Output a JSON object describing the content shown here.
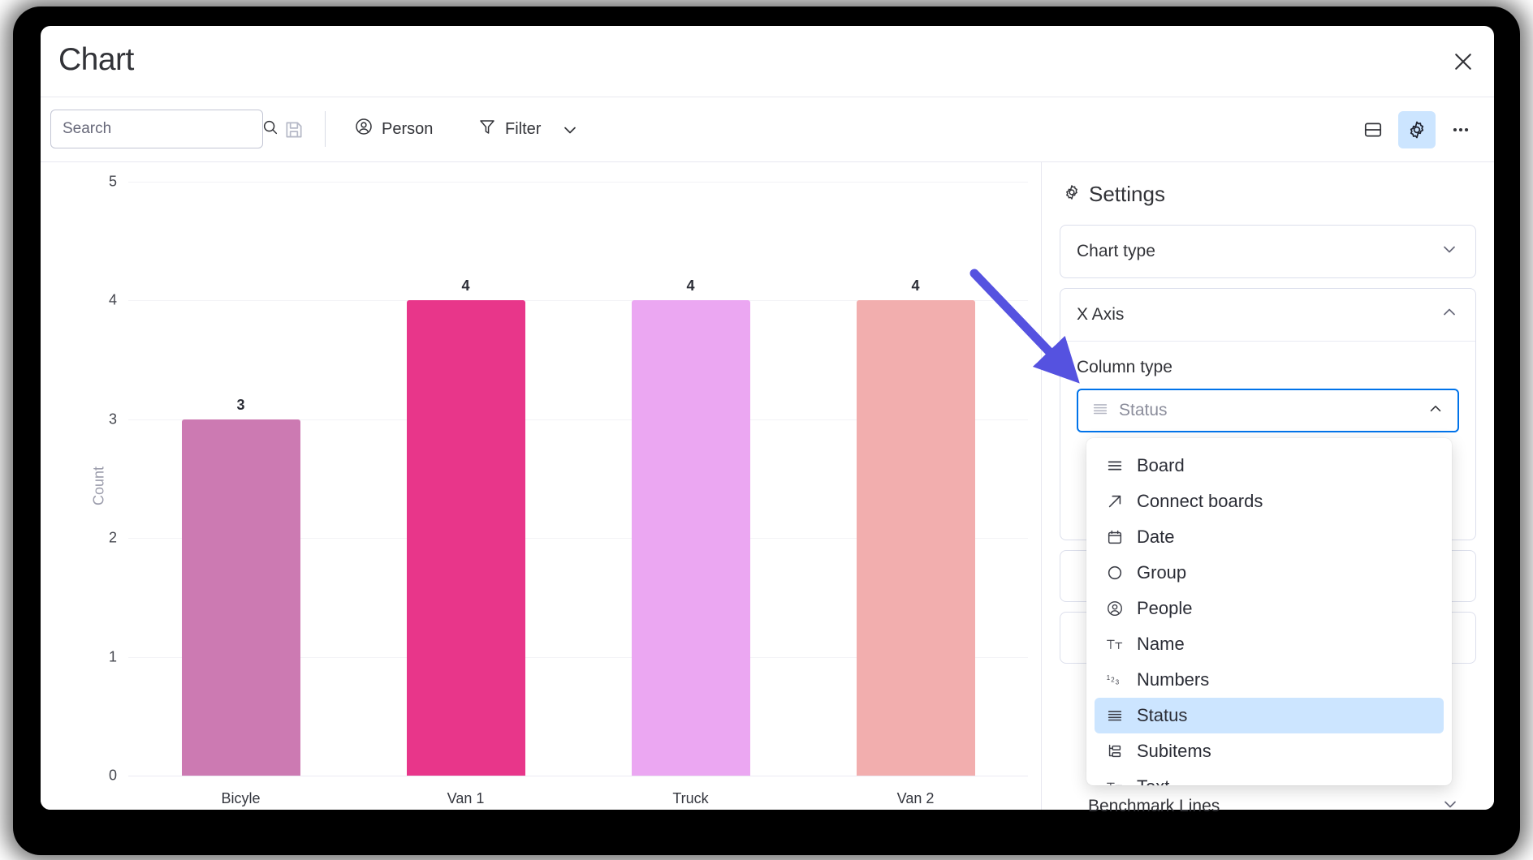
{
  "window": {
    "title": "Chart",
    "close_icon": "close-icon"
  },
  "toolbar": {
    "search": {
      "placeholder": "Search",
      "value": "",
      "icon": "search-icon"
    },
    "save_icon": "save-disk-icon",
    "person": {
      "label": "Person",
      "icon": "person-circle-icon"
    },
    "filter": {
      "label": "Filter",
      "icon": "funnel-icon",
      "chevron": "chevron-down-icon"
    },
    "right_icons": [
      {
        "name": "split-view-icon",
        "active": false
      },
      {
        "name": "gear-icon",
        "active": true
      },
      {
        "name": "more-dots-icon",
        "active": false
      }
    ]
  },
  "chart_data": {
    "type": "bar",
    "title": "",
    "xlabel": "",
    "ylabel": "Count",
    "categories": [
      "Bicyle",
      "Van 1",
      "Truck",
      "Van 2"
    ],
    "values": [
      3,
      4,
      4,
      4
    ],
    "colors": [
      "#cc7ab2",
      "#e8368a",
      "#eba7f2",
      "#f2aeae"
    ],
    "ylim": [
      0,
      5
    ],
    "yticks": [
      "0",
      "1",
      "2",
      "3",
      "4",
      "5"
    ],
    "grid": true,
    "legend": "none"
  },
  "settings": {
    "title": "Settings",
    "gear_icon": "gear-icon",
    "panels": [
      {
        "label": "Chart type",
        "state": "collapsed",
        "chevron": "chevron-down-icon"
      },
      {
        "label": "X Axis",
        "state": "expanded",
        "chevron": "chevron-up-icon"
      }
    ],
    "x_axis": {
      "field_label": "Column type",
      "select": {
        "value": "Status",
        "icon": "status-lines-icon",
        "chevron": "chevron-up-icon",
        "open": true
      }
    },
    "benchmark": {
      "label": "Benchmark Lines",
      "chevron": "chevron-down-icon"
    }
  },
  "dropdown": {
    "options": [
      {
        "label": "Board",
        "icon": "board-lines-icon",
        "selected": false
      },
      {
        "label": "Connect boards",
        "icon": "arrow-up-right-icon",
        "selected": false
      },
      {
        "label": "Date",
        "icon": "calendar-icon",
        "selected": false
      },
      {
        "label": "Group",
        "icon": "circle-icon",
        "selected": false
      },
      {
        "label": "People",
        "icon": "person-circle-icon",
        "selected": false
      },
      {
        "label": "Name",
        "icon": "text-tt-icon",
        "selected": false
      },
      {
        "label": "Numbers",
        "icon": "numbers-123-icon",
        "selected": false
      },
      {
        "label": "Status",
        "icon": "status-lines-icon",
        "selected": true
      },
      {
        "label": "Subitems",
        "icon": "subitems-tree-icon",
        "selected": false
      },
      {
        "label": "Text",
        "icon": "text-tt-icon",
        "selected": false
      }
    ]
  },
  "annotation": {
    "arrow_color": "#5552e0",
    "arrow_name": "pointer-arrow-annotation"
  }
}
